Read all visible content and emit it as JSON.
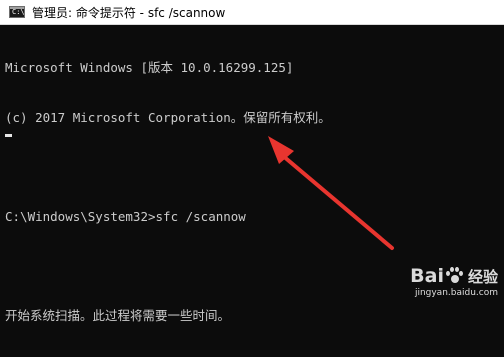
{
  "window": {
    "title": "管理员: 命令提示符 - sfc  /scannow",
    "icon": "cmd-app-icon",
    "icon_glyph": "C:\\"
  },
  "console": {
    "lines": [
      "Microsoft Windows [版本 10.0.16299.125]",
      "(c) 2017 Microsoft Corporation。保留所有权利。",
      "",
      "C:\\Windows\\System32>sfc /scannow",
      "",
      "开始系统扫描。此过程将需要一些时间。"
    ]
  },
  "annotation": {
    "color": "#e8352f",
    "icon": "red-arrow"
  },
  "watermark": {
    "brand_left": "Bai",
    "brand_right": "经验",
    "url": "jingyan.baidu.com"
  }
}
